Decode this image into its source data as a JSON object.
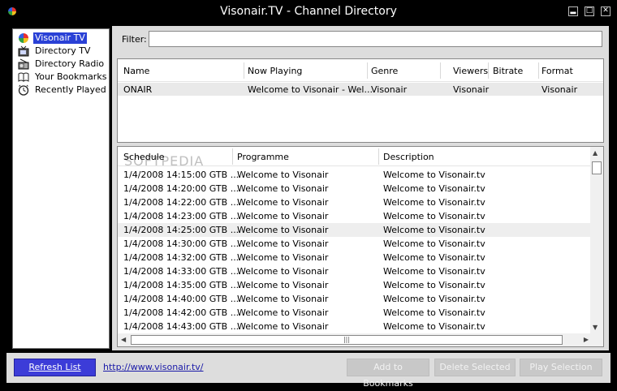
{
  "window": {
    "title": "Visonair.TV - Channel Directory",
    "controls": [
      "minimize",
      "maximize",
      "close"
    ]
  },
  "sidebar": {
    "items": [
      {
        "label": "Visonair TV",
        "icon": "rainbow-icon",
        "selected": true
      },
      {
        "label": "Directory TV",
        "icon": "tv-icon",
        "selected": false
      },
      {
        "label": "Directory Radio",
        "icon": "radio-icon",
        "selected": false
      },
      {
        "label": "Your Bookmarks",
        "icon": "book-icon",
        "selected": false
      },
      {
        "label": "Recently Played",
        "icon": "clock-icon",
        "selected": false
      }
    ]
  },
  "filter": {
    "label": "Filter:",
    "value": ""
  },
  "channels": {
    "columns": [
      "Name",
      "Now Playing",
      "Genre",
      "Viewers",
      "Bitrate",
      "Format"
    ],
    "rows": [
      [
        "ONAIR",
        "Welcome to Visonair - Wel...",
        "Visonair",
        "Visonair",
        "",
        "Visonair"
      ]
    ]
  },
  "schedule": {
    "columns": [
      "Schedule",
      "Programme",
      "Description"
    ],
    "watermark": "SOFTPEDIA",
    "rows": [
      [
        "1/4/2008 14:15:00 GTB ...",
        "Welcome to Visonair",
        "Welcome to Visonair.tv"
      ],
      [
        "1/4/2008 14:20:00 GTB ...",
        "Welcome to Visonair",
        "Welcome to Visonair.tv"
      ],
      [
        "1/4/2008 14:22:00 GTB ...",
        "Welcome to Visonair",
        "Welcome to Visonair.tv"
      ],
      [
        "1/4/2008 14:23:00 GTB ...",
        "Welcome to Visonair",
        "Welcome to Visonair.tv"
      ],
      [
        "1/4/2008 14:25:00 GTB ...",
        "Welcome to Visonair",
        "Welcome to Visonair.tv"
      ],
      [
        "1/4/2008 14:30:00 GTB ...",
        "Welcome to Visonair",
        "Welcome to Visonair.tv"
      ],
      [
        "1/4/2008 14:32:00 GTB ...",
        "Welcome to Visonair",
        "Welcome to Visonair.tv"
      ],
      [
        "1/4/2008 14:33:00 GTB ...",
        "Welcome to Visonair",
        "Welcome to Visonair.tv"
      ],
      [
        "1/4/2008 14:35:00 GTB ...",
        "Welcome to Visonair",
        "Welcome to Visonair.tv"
      ],
      [
        "1/4/2008 14:40:00 GTB ...",
        "Welcome to Visonair",
        "Welcome to Visonair.tv"
      ],
      [
        "1/4/2008 14:42:00 GTB ...",
        "Welcome to Visonair",
        "Welcome to Visonair.tv"
      ],
      [
        "1/4/2008 14:43:00 GTB ...",
        "Welcome to Visonair",
        "Welcome to Visonair.tv"
      ]
    ],
    "highlighted_row": 4
  },
  "footer": {
    "refresh_label": "Refresh List",
    "link": "http://www.visonair.tv/",
    "add_bookmark_label": "Add to Bookmarks",
    "delete_label": "Delete Selected",
    "play_label": "Play Selection"
  },
  "colors": {
    "accent": "#3c3cd8",
    "selection": "#2a41d6",
    "window_bg": "#000000",
    "panel_bg": "#dddddd"
  }
}
